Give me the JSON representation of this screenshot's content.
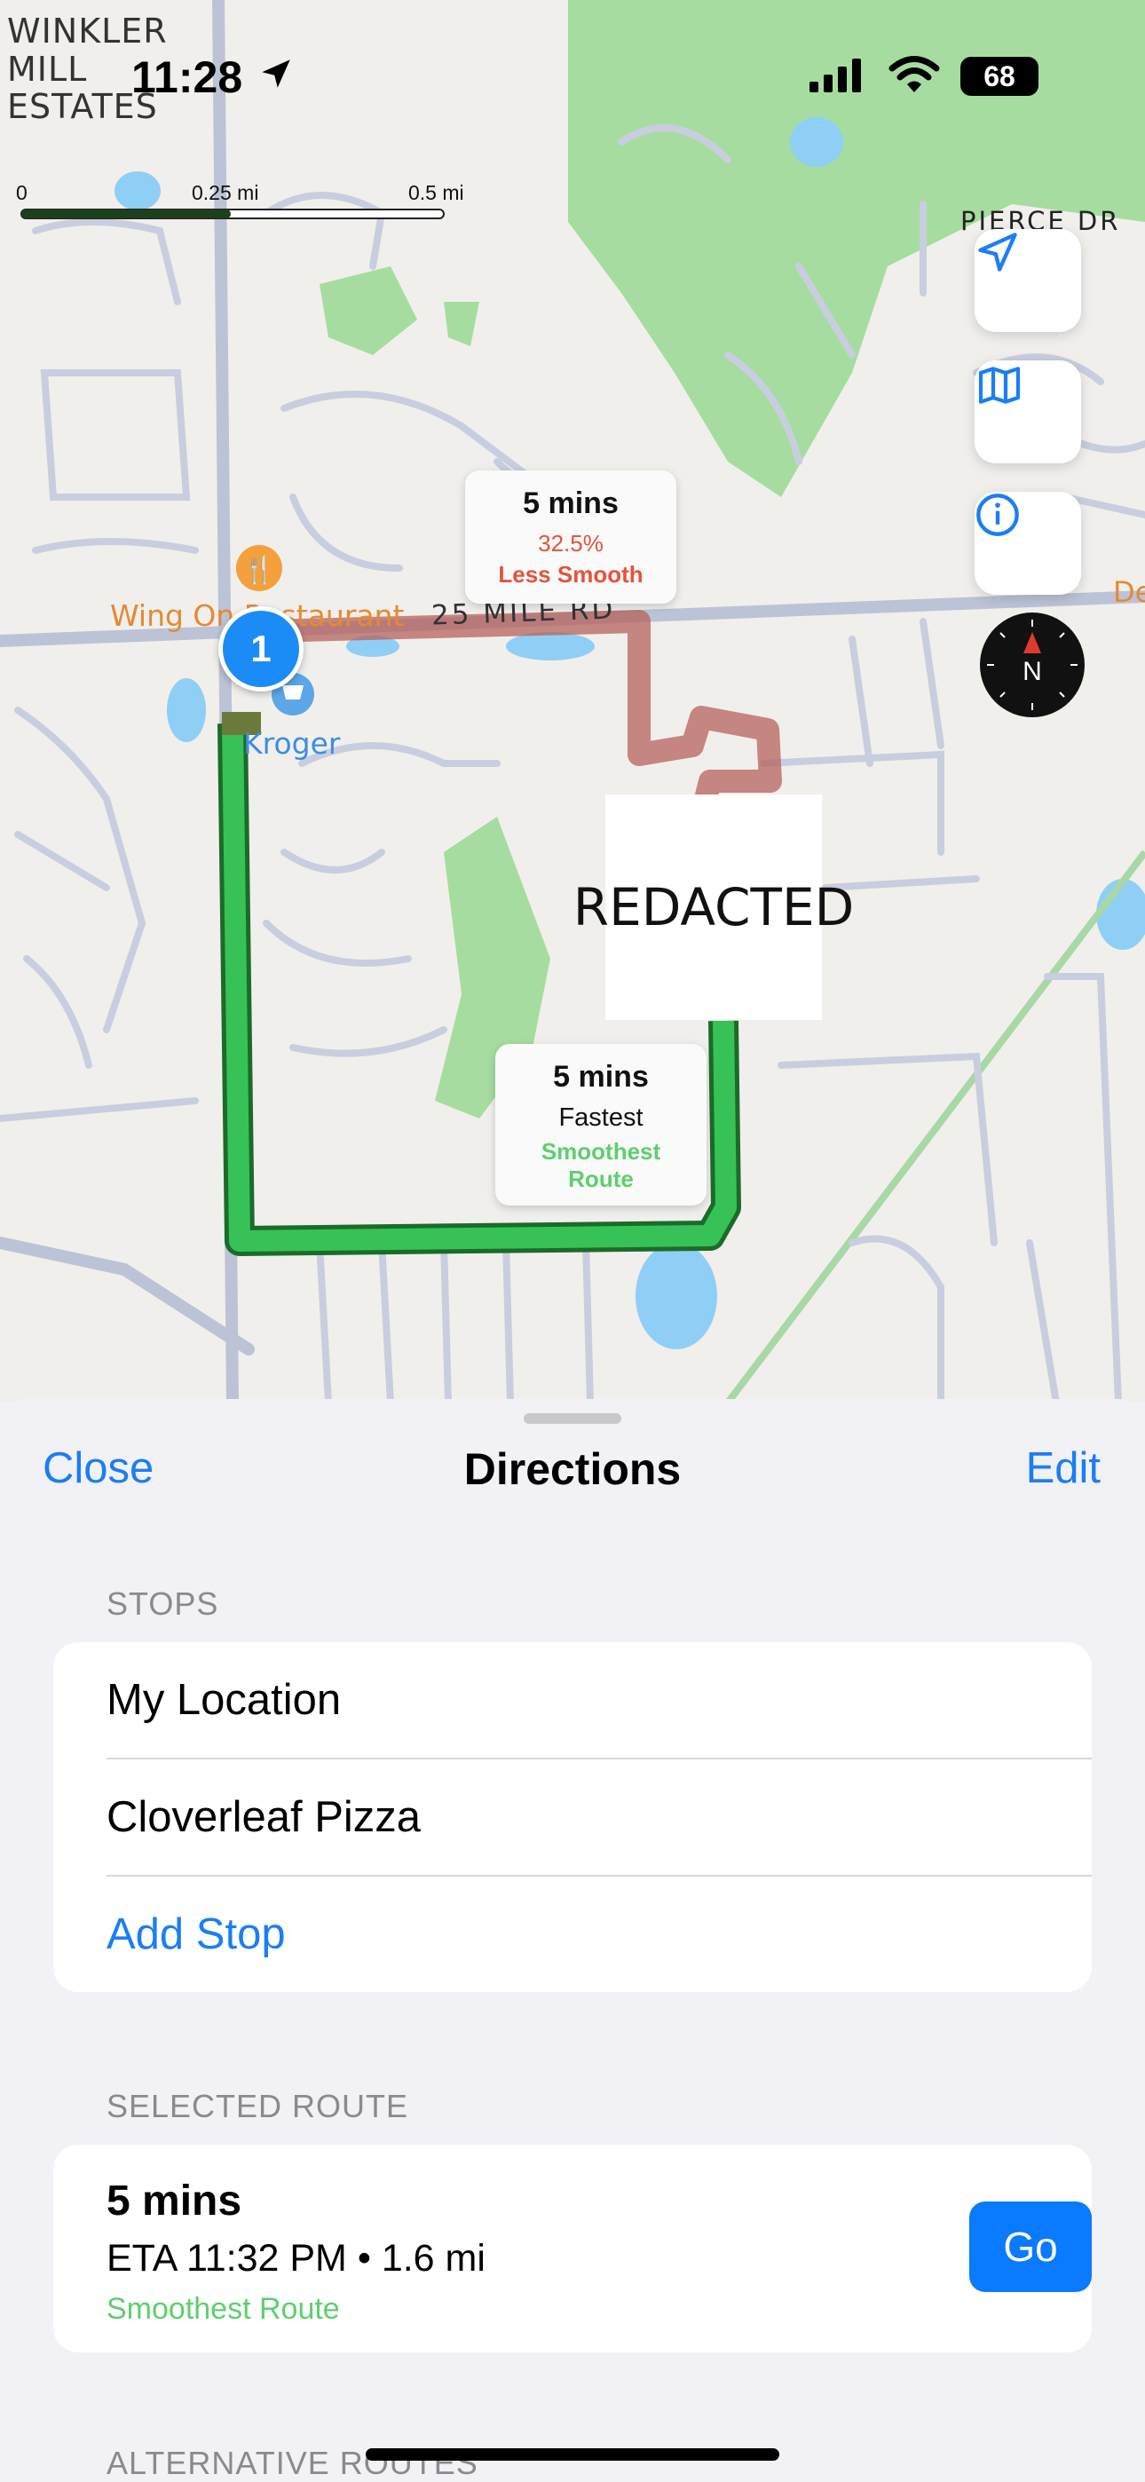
{
  "status_bar": {
    "time": "11:28",
    "battery": "68"
  },
  "map": {
    "area_name": "WINKLER MILL ESTATES",
    "scale": {
      "labels": [
        "0",
        "0.25 mi",
        "0.5 mi"
      ]
    },
    "road_labels": {
      "mile_road": "25 MILE RD",
      "pierce": "PIERCE DR",
      "right_edge": "De"
    },
    "poi": {
      "restaurant": "Wing On Restaurant",
      "store": "Kroger"
    },
    "route_alt_callout": {
      "time": "5 mins",
      "pct": "32.5%",
      "desc": "Less Smooth"
    },
    "route_main_callout": {
      "time": "5 mins",
      "line1": "Fastest",
      "line2": "Smoothest",
      "line3": "Route"
    },
    "redacted": "REDACTED",
    "pin_number": "1",
    "compass_label": "N",
    "controls": [
      "location-arrow-icon",
      "map-icon",
      "info-icon"
    ]
  },
  "sheet": {
    "close": "Close",
    "title": "Directions",
    "edit": "Edit",
    "stops_label": "STOPS",
    "stops": [
      "My Location",
      "Cloverleaf Pizza"
    ],
    "add_stop": "Add Stop",
    "selected_route_label": "SELECTED ROUTE",
    "selected_route": {
      "time": "5 mins",
      "eta": "ETA 11:32 PM • 1.6 mi",
      "tag": "Smoothest Route",
      "go": "Go"
    },
    "alternative_routes_label": "ALTERNATIVE ROUTES"
  },
  "colors": {
    "accent": "#0a7aff",
    "route_main": "#34c759",
    "route_alt": "#b5615c",
    "tag_green": "#5ecf6e",
    "less_smooth": "#e5533d"
  }
}
